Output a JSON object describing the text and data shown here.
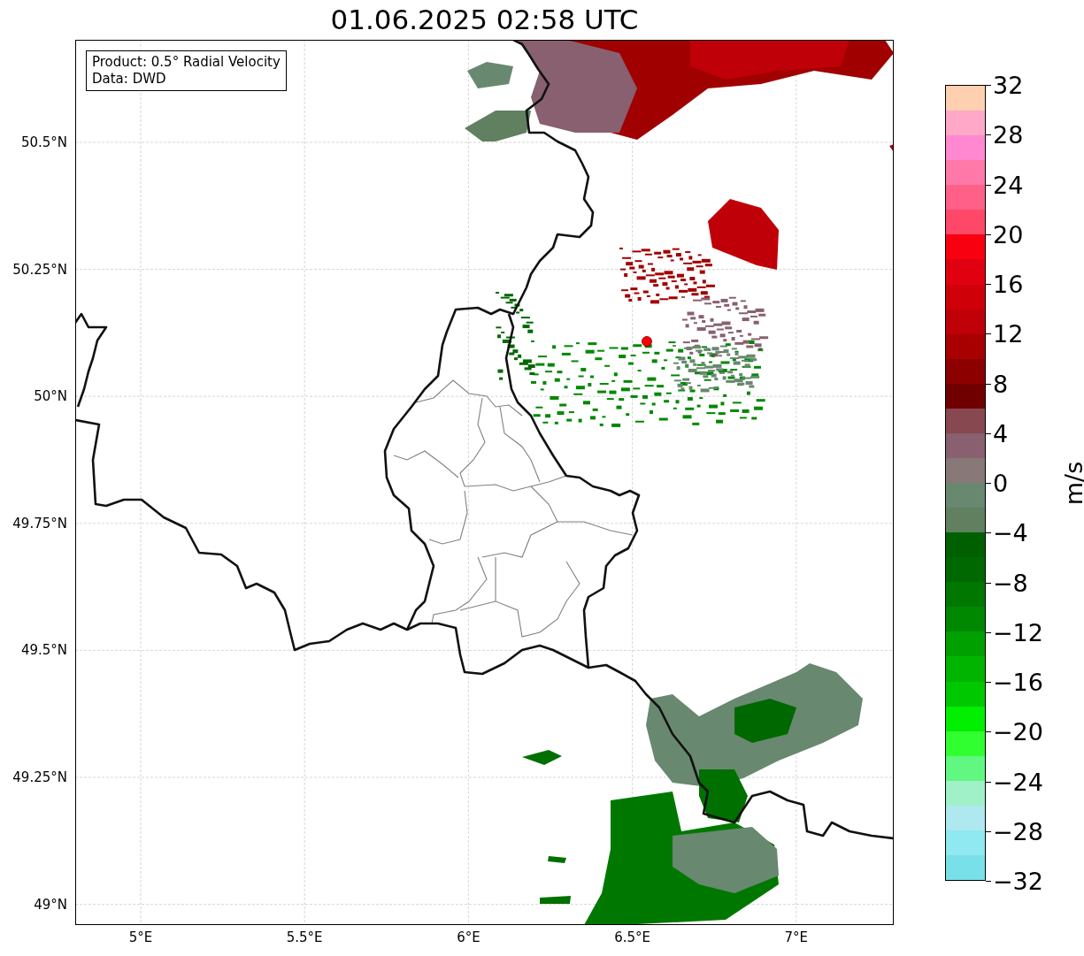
{
  "title": "01.06.2025 02:58 UTC",
  "info_box": {
    "lines": [
      "Product: 0.5° Radial Velocity",
      "Data: DWD"
    ]
  },
  "map": {
    "latitude_labels": [
      "50.5°N",
      "50.25°N",
      "50°N",
      "49.75°N",
      "49.5°N",
      "49.25°N",
      "49°N"
    ],
    "longitude_labels": [
      "5°E",
      "5.5°E",
      "6°E",
      "6.5°E",
      "7°E"
    ]
  },
  "colorbar": {
    "label": "m/s",
    "ticks": [
      "32",
      "28",
      "24",
      "20",
      "16",
      "12",
      "8",
      "4",
      "0",
      "−4",
      "−8",
      "−12",
      "−16",
      "−20",
      "−24",
      "−28",
      "−32"
    ],
    "bands": [
      {
        "color": "#ffd0b0"
      },
      {
        "color": "#ffa8c8"
      },
      {
        "color": "#ff88d0"
      },
      {
        "color": "#ff78a8"
      },
      {
        "color": "#ff6088"
      },
      {
        "color": "#ff4868"
      },
      {
        "color": "#f80010"
      },
      {
        "color": "#e00010"
      },
      {
        "color": "#d00008"
      },
      {
        "color": "#c00008"
      },
      {
        "color": "#a80000"
      },
      {
        "color": "#8c0000"
      },
      {
        "color": "#700000"
      },
      {
        "color": "#884850"
      },
      {
        "color": "#886070"
      },
      {
        "color": "#887878"
      },
      {
        "color": "#688870"
      },
      {
        "color": "#608060"
      },
      {
        "color": "#006000"
      },
      {
        "color": "#006800"
      },
      {
        "color": "#007800"
      },
      {
        "color": "#008800"
      },
      {
        "color": "#00a000"
      },
      {
        "color": "#00b400"
      },
      {
        "color": "#00c800"
      },
      {
        "color": "#00f000"
      },
      {
        "color": "#30ff30"
      },
      {
        "color": "#60f880"
      },
      {
        "color": "#a0f0c8"
      },
      {
        "color": "#b0e8f0"
      },
      {
        "color": "#90e8f0"
      },
      {
        "color": "#78e0e8"
      }
    ]
  }
}
